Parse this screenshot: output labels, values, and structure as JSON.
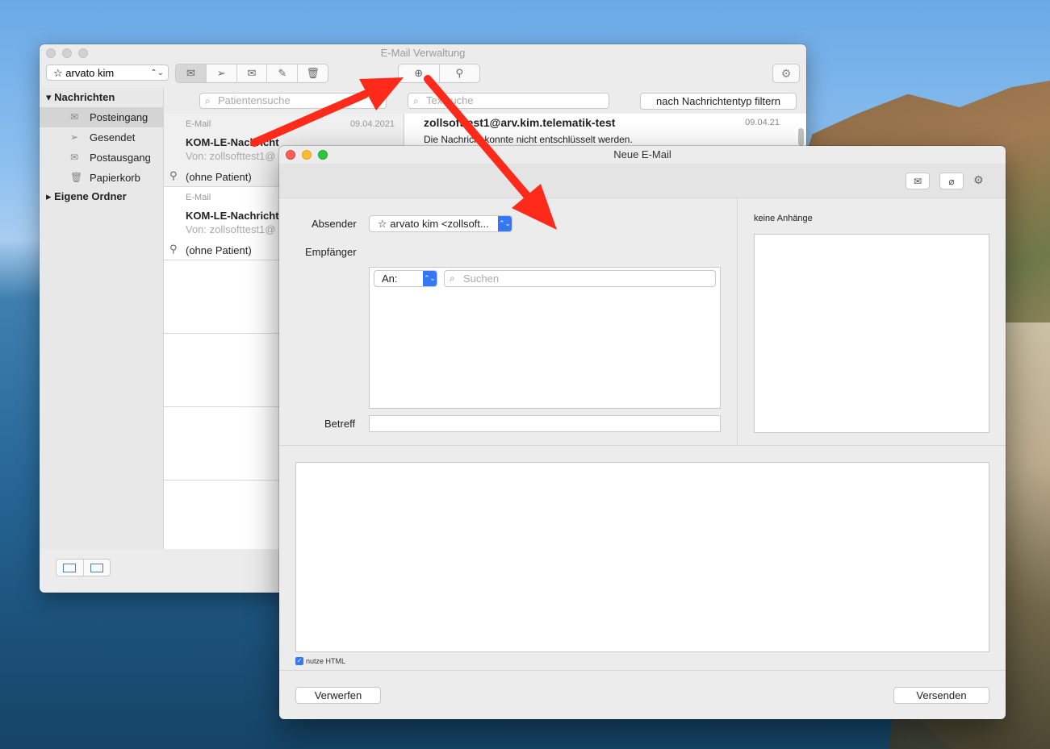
{
  "back_window": {
    "title": "E-Mail Verwaltung",
    "account": "arvato kim",
    "search_patient_placeholder": "Patientensuche",
    "search_text_placeholder": "Textsuche",
    "filter_button": "nach Nachrichtentyp filtern",
    "sidebar": {
      "group_messages": "Nachrichten",
      "items": [
        {
          "label": "Posteingang",
          "icon": "inbox-icon"
        },
        {
          "label": "Gesendet",
          "icon": "paper-plane-icon"
        },
        {
          "label": "Postausgang",
          "icon": "envelope-icon"
        },
        {
          "label": "Papierkorb",
          "icon": "trash-icon"
        }
      ],
      "group_folders": "Eigene Ordner"
    },
    "messages": [
      {
        "type": "E-Mail",
        "date": "09.04.2021",
        "title": "KOM-LE-Nachricht",
        "from": "Von: zollsofttest1@",
        "patient": "(ohne Patient)"
      },
      {
        "type": "E-Mail",
        "date": "",
        "title": "KOM-LE-Nachricht",
        "from": "Von: zollsofttest1@",
        "patient": "(ohne Patient)"
      }
    ],
    "detail": {
      "from": "zollsofttest1@arv.kim.telematik-test",
      "date": "09.04.21",
      "body": "Die Nachricht konnte nicht entschlüsselt werden."
    }
  },
  "compose_window": {
    "title": "Neue E-Mail",
    "sender_label": "Absender",
    "sender_value": "arvato kim <zollsoft...",
    "recipient_label": "Empfänger",
    "recipient_type": "An:",
    "recipient_search_placeholder": "Suchen",
    "subject_label": "Betreff",
    "attachments_label": "keine Anhänge",
    "use_html_label": "nutze HTML",
    "discard_button": "Verwerfen",
    "send_button": "Versenden"
  },
  "colors": {
    "annotation_arrow": "#ff2a1a",
    "accent": "#3478f6"
  }
}
